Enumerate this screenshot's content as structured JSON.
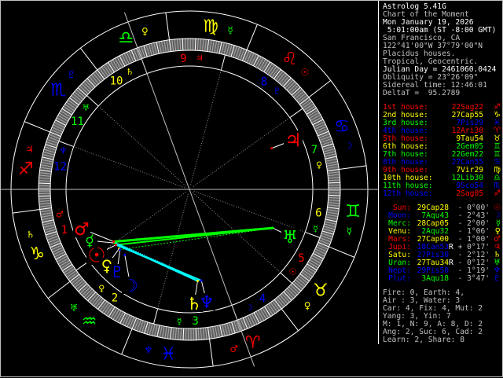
{
  "colors": {
    "white": "#ffffff",
    "grey": "#c0c0c0",
    "red": "#ff0000",
    "yellow": "#ffff00",
    "green": "#00ff00",
    "blue": "#0000ff",
    "cyan": "#00ffff"
  },
  "info": [
    {
      "text": "Astrolog 5.41G",
      "color": "#ffffff"
    },
    {
      "text": "Chart of the Moment",
      "color": "#c0c0c0"
    },
    {
      "text": "Mon January 19, 2026",
      "color": "#ffffff"
    },
    {
      "text": " 5:01:00am (ST -8:00 GMT)",
      "color": "#ffffff"
    },
    {
      "text": "San Francisco, CA",
      "color": "#c0c0c0"
    },
    {
      "text": "122°41'00\"W 37°79'00\"N",
      "color": "#c0c0c0"
    },
    {
      "text": "Placidus houses.",
      "color": "#c0c0c0"
    },
    {
      "text": "Tropical, Geocentric.",
      "color": "#c0c0c0"
    },
    {
      "text": "Julian Day = 2461060.0424",
      "color": "#ffffff"
    },
    {
      "text": "Obliquity = 23°26'09\"",
      "color": "#c0c0c0"
    },
    {
      "text": "Sidereal time: 12:46:01",
      "color": "#c0c0c0"
    },
    {
      "text": "DeltaT =  95.2789",
      "color": "#c0c0c0"
    }
  ],
  "houses": [
    {
      "label": "1st house:",
      "cusp": "22Sag22",
      "glyph": "♐",
      "color": "#ff0000",
      "sign_color": "#ff0000",
      "lon": 262.37
    },
    {
      "label": "2nd house:",
      "cusp": "27Cap55",
      "glyph": "♑",
      "color": "#ffff00",
      "sign_color": "#ffff00",
      "lon": 297.92
    },
    {
      "label": "3rd house:",
      "cusp": "7Pis29",
      "glyph": "♓",
      "color": "#00ff00",
      "sign_color": "#0000ff",
      "lon": 337.48
    },
    {
      "label": "4th house:",
      "cusp": "12Ari30",
      "glyph": "♈",
      "color": "#0000ff",
      "sign_color": "#ff0000",
      "lon": 12.5
    },
    {
      "label": "5th house:",
      "cusp": "9Tau54",
      "glyph": "♉",
      "color": "#ff0000",
      "sign_color": "#ffff00",
      "lon": 39.9
    },
    {
      "label": "6th house:",
      "cusp": "2Gem05",
      "glyph": "♊",
      "color": "#ffff00",
      "sign_color": "#00ff00",
      "lon": 62.08
    },
    {
      "label": "7th house:",
      "cusp": "22Gem22",
      "glyph": "♊",
      "color": "#00ff00",
      "sign_color": "#00ff00",
      "lon": 82.37
    },
    {
      "label": "8th house:",
      "cusp": "27Can55",
      "glyph": "♋",
      "color": "#0000ff",
      "sign_color": "#0000ff",
      "lon": 117.92
    },
    {
      "label": "9th house:",
      "cusp": "7Vir29",
      "glyph": "♍",
      "color": "#ff0000",
      "sign_color": "#ffff00",
      "lon": 157.48
    },
    {
      "label": "10th house:",
      "cusp": "12Lib30",
      "glyph": "♎",
      "color": "#ffff00",
      "sign_color": "#00ff00",
      "lon": 192.5
    },
    {
      "label": "11th house:",
      "cusp": "9Sco54",
      "glyph": "♏",
      "color": "#00ff00",
      "sign_color": "#0000ff",
      "lon": 219.9
    },
    {
      "label": "12th house:",
      "cusp": "2Sag05",
      "glyph": "♐",
      "color": "#0000ff",
      "sign_color": "#ff0000",
      "lon": 242.08
    }
  ],
  "planets": [
    {
      "id": "sun",
      "name": "Sun:",
      "pos": "29Cap28",
      "retro": "",
      "aspect": "- 0°00'",
      "glyph": "☉",
      "color": "#ff0000",
      "pos_color": "#ffff00",
      "lon": 299.47
    },
    {
      "id": "moon",
      "name": "Moon:",
      "pos": "7Aqu43",
      "retro": "",
      "aspect": "- 2°43'",
      "glyph": "☽",
      "color": "#0000ff",
      "pos_color": "#00ff00",
      "lon": 307.72
    },
    {
      "id": "mercury",
      "name": "Merc:",
      "pos": "28Cap05",
      "retro": "",
      "aspect": "- 2°00'",
      "glyph": "☿",
      "color": "#00ff00",
      "pos_color": "#ffff00",
      "lon": 298.08
    },
    {
      "id": "venus",
      "name": "Venu:",
      "pos": "2Aqu32",
      "retro": "",
      "aspect": "- 1°06'",
      "glyph": "♀",
      "color": "#ffff00",
      "pos_color": "#00ff00",
      "lon": 302.53
    },
    {
      "id": "mars",
      "name": "Mars:",
      "pos": "27Cap00",
      "retro": "",
      "aspect": "- 1°00'",
      "glyph": "♂",
      "color": "#ff0000",
      "pos_color": "#ffff00",
      "lon": 297.0
    },
    {
      "id": "jupiter",
      "name": "Jupi:",
      "pos": "18Can53",
      "retro": "R",
      "aspect": "+ 0°17'",
      "glyph": "♃",
      "color": "#ff0000",
      "pos_color": "#0000ff",
      "lon": 108.88
    },
    {
      "id": "saturn",
      "name": "Satu:",
      "pos": "27Pis30",
      "retro": "",
      "aspect": "- 2°12'",
      "glyph": "♄",
      "color": "#ffff00",
      "pos_color": "#0000ff",
      "lon": 357.5
    },
    {
      "id": "uranus",
      "name": "Uran:",
      "pos": "27Tau34",
      "retro": "R",
      "aspect": "- 0°12'",
      "glyph": "♅",
      "color": "#00ff00",
      "pos_color": "#ffff00",
      "lon": 57.57
    },
    {
      "id": "neptune",
      "name": "Nept:",
      "pos": "29Pis50",
      "retro": "",
      "aspect": "- 1°19'",
      "glyph": "♆",
      "color": "#0000ff",
      "pos_color": "#0000ff",
      "lon": 359.83
    },
    {
      "id": "pluto",
      "name": "Plut:",
      "pos": "3Aqu18",
      "retro": "",
      "aspect": "- 3°47'",
      "glyph": "♇",
      "color": "#0000ff",
      "pos_color": "#00ff00",
      "lon": 303.3
    }
  ],
  "stats": [
    "Fire: 0, Earth: 4,",
    "Air : 3, Water: 3",
    "Car: 4, Fix: 4, Mut: 2",
    "Yang: 3, Yin: 7",
    "M: 1, N: 9, A: 8, D: 2",
    "Ang: 2, Suc: 6, Cad: 2",
    "Learn: 2, Share: 8"
  ],
  "wheel": {
    "signs": [
      {
        "name": "aries",
        "glyph": "♈",
        "color": "#ff0000",
        "ruler": "♂",
        "ruler_color": "#ff0000"
      },
      {
        "name": "taurus",
        "glyph": "♉",
        "color": "#ffff00",
        "ruler": "♀",
        "ruler_color": "#ffff00"
      },
      {
        "name": "gemini",
        "glyph": "♊",
        "color": "#00ff00",
        "ruler": "☿",
        "ruler_color": "#00ff00"
      },
      {
        "name": "cancer",
        "glyph": "♋",
        "color": "#0000ff",
        "ruler": "☽",
        "ruler_color": "#0000ff"
      },
      {
        "name": "leo",
        "glyph": "♌",
        "color": "#ff0000",
        "ruler": "☉",
        "ruler_color": "#ff0000"
      },
      {
        "name": "virgo",
        "glyph": "♍",
        "color": "#ffff00",
        "ruler": "☿",
        "ruler_color": "#00ff00"
      },
      {
        "name": "libra",
        "glyph": "♎",
        "color": "#00ff00",
        "ruler": "♀",
        "ruler_color": "#ffff00"
      },
      {
        "name": "scorpio",
        "glyph": "♏",
        "color": "#0000ff",
        "ruler": "♇",
        "ruler_color": "#0000ff"
      },
      {
        "name": "sagittarius",
        "glyph": "♐",
        "color": "#ff0000",
        "ruler": "♃",
        "ruler_color": "#ff0000"
      },
      {
        "name": "capricorn",
        "glyph": "♑",
        "color": "#ffff00",
        "ruler": "♄",
        "ruler_color": "#ffff00"
      },
      {
        "name": "aquarius",
        "glyph": "♒",
        "color": "#00ff00",
        "ruler": "♅",
        "ruler_color": "#00ff00"
      },
      {
        "name": "pisces",
        "glyph": "♓",
        "color": "#0000ff",
        "ruler": "♆",
        "ruler_color": "#0000ff"
      }
    ],
    "house_numbers": [
      "1",
      "2",
      "3",
      "4",
      "5",
      "6",
      "7",
      "8",
      "9",
      "10",
      "11",
      "12"
    ]
  }
}
